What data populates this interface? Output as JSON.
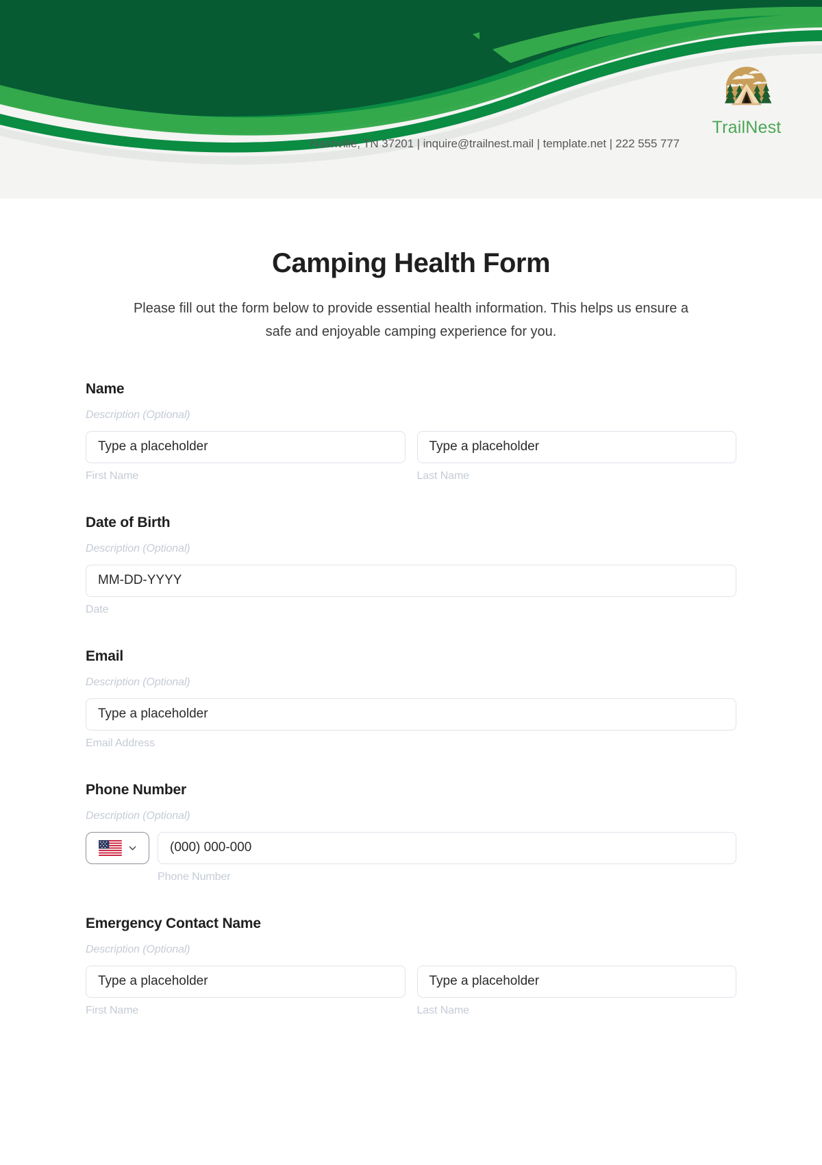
{
  "header": {
    "brand_name": "TrailNest",
    "contact_line": "Nashville, TN 37201 | inquire@trailnest.mail | template.net | 222 555 777",
    "logo_icon": "camping-tent-forest-icon",
    "colors": {
      "dark_green": "#065B33",
      "mid_green": "#0A8C43",
      "bright_green": "#34A94B",
      "header_bg": "#F4F4F2",
      "brand_text": "#4CA757",
      "logo_sun": "#C89F5A",
      "logo_tree": "#1F5C2E",
      "logo_tent": "#F5DCB8"
    }
  },
  "form": {
    "title": "Camping Health Form",
    "subtitle": "Please fill out the form below to provide essential health information. This helps us ensure a safe and enjoyable camping experience for you.",
    "description_placeholder": "Description (Optional)",
    "fields": [
      {
        "label": "Name",
        "description": "Description (Optional)",
        "type": "name-pair",
        "inputs": [
          {
            "placeholder": "Type a placeholder",
            "sub_label": "First Name"
          },
          {
            "placeholder": "Type a placeholder",
            "sub_label": "Last Name"
          }
        ]
      },
      {
        "label": "Date of Birth",
        "description": "Description (Optional)",
        "type": "date",
        "inputs": [
          {
            "placeholder": "MM-DD-YYYY",
            "sub_label": "Date"
          }
        ]
      },
      {
        "label": "Email",
        "description": "Description (Optional)",
        "type": "email",
        "inputs": [
          {
            "placeholder": "Type a placeholder",
            "sub_label": "Email Address"
          }
        ]
      },
      {
        "label": "Phone Number",
        "description": "Description (Optional)",
        "type": "phone",
        "country_flag": "us-flag-icon",
        "country_chevron": "chevron-down-icon",
        "inputs": [
          {
            "placeholder": "(000) 000-000",
            "sub_label": "Phone Number"
          }
        ]
      },
      {
        "label": "Emergency Contact Name",
        "description": "Description (Optional)",
        "type": "name-pair",
        "inputs": [
          {
            "placeholder": "Type a placeholder",
            "sub_label": "First Name"
          },
          {
            "placeholder": "Type a placeholder",
            "sub_label": "Last Name"
          }
        ]
      }
    ]
  }
}
